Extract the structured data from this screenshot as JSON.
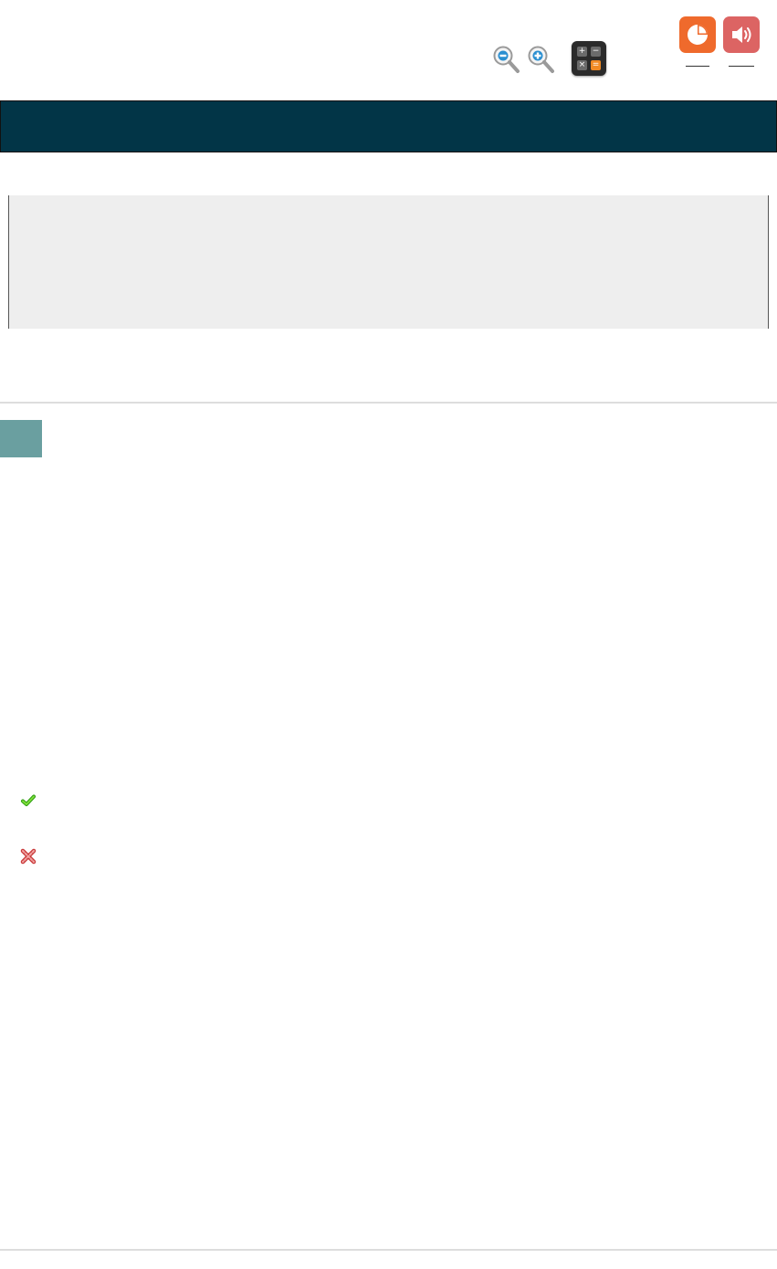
{
  "toolbar": {
    "icons": [
      "zoom-out-icon",
      "zoom-in-icon",
      "calculator-icon",
      "progress-pie-icon",
      "speaker-icon"
    ],
    "calculator_keys": [
      "+",
      "−",
      "×",
      "="
    ],
    "colors": {
      "zoom_minus": "#2a8fd1",
      "progress_tile": "#ef6a2c",
      "audio_tile": "#dc6463",
      "calculator": "#2b2b2b",
      "calculator_accent": "#f08a24"
    }
  },
  "header_bar": {
    "color": "#023547"
  },
  "passage": {
    "background": "#eeeeee"
  },
  "question": {
    "number_badge_color": "#6a9fa0"
  },
  "answer_marks": [
    "correct-check-icon",
    "incorrect-cross-icon"
  ]
}
